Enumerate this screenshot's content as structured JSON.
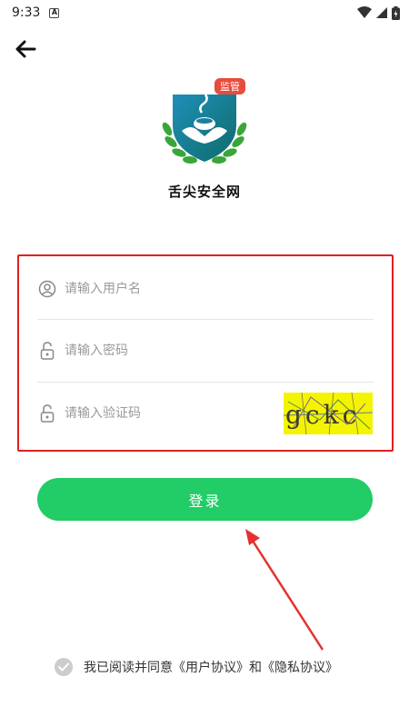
{
  "status_bar": {
    "time": "9:33",
    "notification_letter": "A"
  },
  "app": {
    "name": "舌尖安全网",
    "badge": "监管"
  },
  "form": {
    "username_placeholder": "请输入用户名",
    "password_placeholder": "请输入密码",
    "captcha_placeholder": "请输入验证码",
    "captcha_text": "gckc"
  },
  "login_button": "登录",
  "agreement": {
    "text": "我已阅读并同意《用户协议》和《隐私协议》",
    "checked": true
  },
  "colors": {
    "primary_green": "#22cc66",
    "highlight_red": "#e02020",
    "captcha_bg": "#f4f400"
  }
}
